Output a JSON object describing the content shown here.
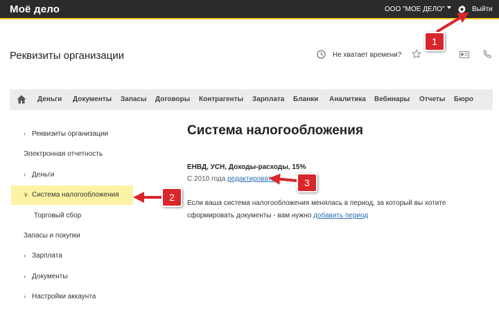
{
  "topbar": {
    "logo": "Моё дело",
    "org": "ООО \"МОЕ ДЕЛО\"",
    "logout": "Выйти",
    "bar_color": "#2b2b2b",
    "accent": "#f3c416"
  },
  "header": {
    "title": "Реквизиты организации",
    "no_time": "Не хватает времени?"
  },
  "nav": {
    "items": [
      "Деньги",
      "Документы",
      "Запасы",
      "Договоры",
      "Контрагенты",
      "Зарплата",
      "Бланки",
      "Аналитика",
      "Вебинары",
      "Отчеты",
      "Бюро"
    ]
  },
  "sidebar": {
    "items": [
      {
        "label": "Реквизиты организации"
      },
      {
        "label": "Электронная отчетность"
      },
      {
        "label": "Деньги"
      },
      {
        "label": "Система налогообложения"
      },
      {
        "label": "Торговый сбор"
      },
      {
        "label": "Запасы и покупки"
      },
      {
        "label": "Зарплата"
      },
      {
        "label": "Документы"
      },
      {
        "label": "Настройки аккаунта"
      }
    ],
    "active_color": "#fcf3a4"
  },
  "main": {
    "title": "Система налогообложения",
    "tax_summary": "ЕНВД, УСН, Доходы-расходы, 15%",
    "since_prefix": "С 2010 года",
    "edit_link": "редактировать",
    "para_line1": "Если ваша система налогообложения менялась в период, за который вы хотите",
    "para_line2": "сформировать документы - вам нужно",
    "add_period_link": "добавить период",
    "link_color": "#2a6db5"
  },
  "annotations": {
    "badge1": "1",
    "badge2": "2",
    "badge3": "3",
    "color": "#d8272b"
  }
}
